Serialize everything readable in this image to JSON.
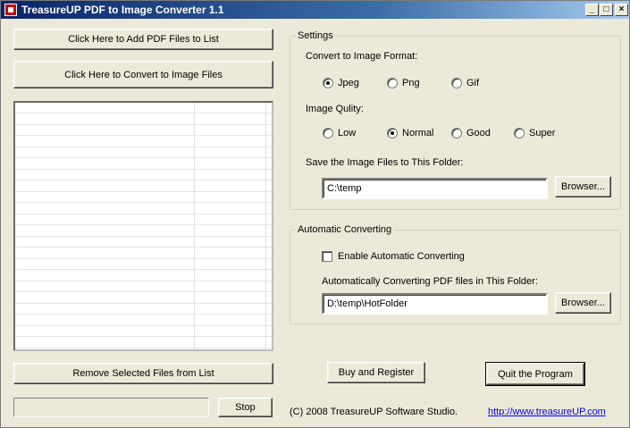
{
  "window": {
    "title": "TreasureUP PDF to Image Converter 1.1",
    "minimize": "_",
    "maximize": "□",
    "close": "×"
  },
  "left": {
    "add_button": "Click Here to Add PDF Files to List",
    "convert_button": "Click Here to Convert to Image Files",
    "remove_button": "Remove Selected Files from List",
    "stop_button": "Stop",
    "progress_value": 0
  },
  "settings": {
    "legend": "Settings",
    "format_label": "Convert to Image Format:",
    "formats": [
      {
        "label": "Jpeg",
        "checked": true
      },
      {
        "label": "Png",
        "checked": false
      },
      {
        "label": "Gif",
        "checked": false
      }
    ],
    "quality_label": "Image Qulity:",
    "qualities": [
      {
        "label": "Low",
        "checked": false
      },
      {
        "label": "Normal",
        "checked": true
      },
      {
        "label": "Good",
        "checked": false
      },
      {
        "label": "Super",
        "checked": false
      }
    ],
    "folder_label": "Save the Image Files to This Folder:",
    "folder_value": "C:\\temp",
    "browse_label": "Browser..."
  },
  "auto": {
    "legend": "Automatic Converting",
    "enable_label": "Enable Automatic Converting",
    "enable_checked": false,
    "folder_label": "Automatically Converting PDF files in This Folder:",
    "folder_value": "D:\\temp\\HotFolder",
    "browse_label": "Browser..."
  },
  "footer": {
    "buy_button": "Buy and Register",
    "quit_button": "Quit the Program",
    "copyright": "(C) 2008 TreasureUP Software Studio.",
    "link": "http://www.treasureUP.com"
  }
}
